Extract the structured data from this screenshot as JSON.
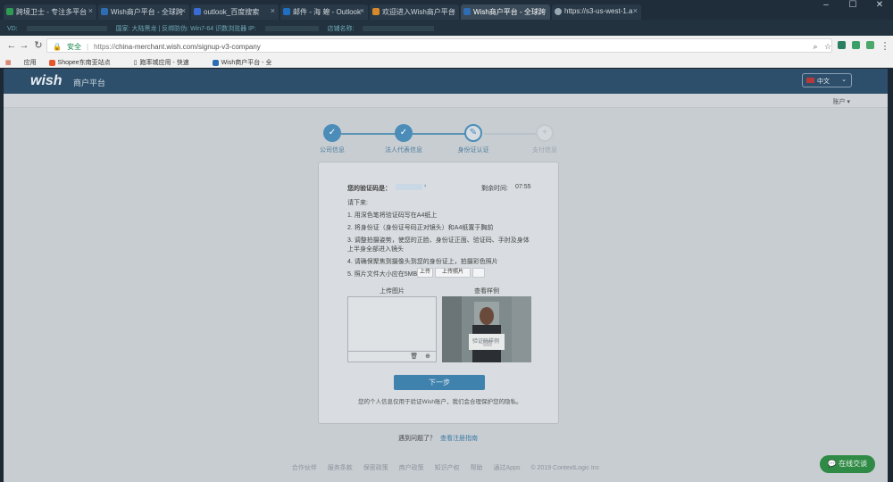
{
  "browser": {
    "tabs": [
      {
        "label": "跨境卫士 - 专注多平台",
        "color": "#2e9b55"
      },
      {
        "label": "Wish商户平台 - 全球跨",
        "color": "#2f6db3"
      },
      {
        "label": "outlook_百度搜索",
        "color": "#3b6cd6"
      },
      {
        "label": "邮件 - 海 蝗 - Outlook",
        "color": "#1f6fc2"
      },
      {
        "label": "欢迎进入Wish商户平台",
        "color": "#d88a2a"
      },
      {
        "label": "Wish商户平台 - 全球跨",
        "color": "#2f6db3"
      },
      {
        "label": "https://s3-us-west-1.a",
        "color": "#9aa8b4"
      }
    ],
    "window_controls": [
      "–",
      "☐",
      "✕"
    ],
    "infobar_left": "VD:",
    "infobar_items": [
      "国家: 大陆黑龙 | 反绑防伪: Win7-64 识数浏览器 IP:",
      "店铺名称:"
    ],
    "secure_label": "安全",
    "url_scheme": "https://",
    "url_rest": "china-merchant.wish.com/signup-v3-company",
    "bookmarks": [
      "应用",
      "Shopee东南亚站点",
      "跑率城应用 - 快速",
      "Wish商户平台 - 全"
    ]
  },
  "header": {
    "logo": "wish",
    "logo_sub": "商户平台",
    "language": "中文",
    "account": "账户 ▾"
  },
  "steps": [
    {
      "label": "公司信息",
      "state": "done"
    },
    {
      "label": "法人代表信息",
      "state": "done"
    },
    {
      "label": "身份证认证",
      "state": "current"
    },
    {
      "label": "支付信息",
      "state": "pending"
    }
  ],
  "verify": {
    "code_label": "您的验证码是：",
    "time_label": "剩余时间:",
    "time_value": "07:55",
    "intro": "请下来:",
    "instructions": [
      "1. 用深色笔将验证码写在A4纸上",
      "2. 将身份证（身份证号码正对镜头）和A4纸置于胸前",
      "3. 调整拍摄姿势，使您的正脸、身份证正面、验证码、手肘及身体",
      "   上半身全部进入镜头",
      "4. 请确保聚焦到摄像头到您的身份证上，拍摄彩色照片",
      "5. 照片文件大小应在5MB以内"
    ],
    "upload_buttons": [
      "上传",
      "上传照片"
    ],
    "upload_label": "上传图片",
    "example_label": "查看样例",
    "example_sign": "验证码样例",
    "next": "下一步",
    "privacy": "您的个人信息仅用于验证Wish账户，我们会合理保护您的隐私。",
    "help_prefix": "遇到问题了？",
    "help_link": "查看注册指南"
  },
  "footer": [
    "合作伙伴",
    "服务条款",
    "保密政策",
    "商户政策",
    "知识产权",
    "帮助",
    "通过Apps",
    "© 2019 ContextLogic Inc"
  ],
  "chat": "在线交谈"
}
